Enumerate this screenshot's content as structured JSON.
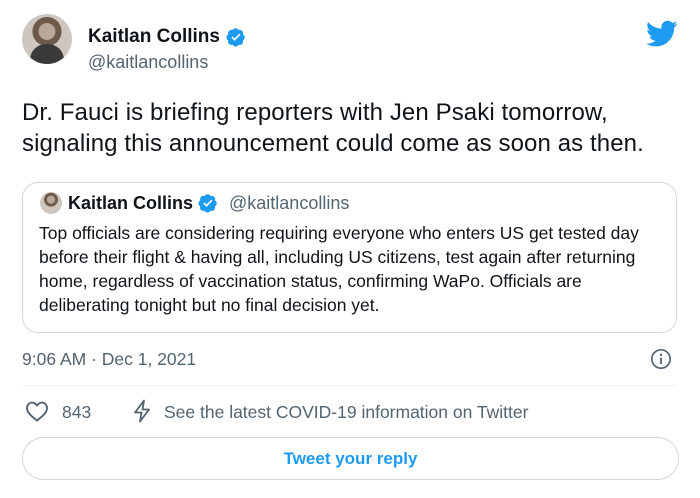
{
  "tweet": {
    "author": {
      "name": "Kaitlan Collins",
      "handle": "@kaitlancollins",
      "verified": true
    },
    "text": "Dr. Fauci is briefing reporters with Jen Psaki tomorrow, signaling this announcement could come as soon as then.",
    "quoted": {
      "author": {
        "name": "Kaitlan Collins",
        "handle": "@kaitlancollins",
        "verified": true
      },
      "text": "Top officials are considering requiring everyone who enters US get tested day before their flight & having all, including US citizens, test again after returning home, regardless of vaccination status, confirming WaPo. Officials are deliberating tonight but no final decision yet."
    },
    "timestamp": "9:06 AM · Dec 1, 2021",
    "likes": "843",
    "covid_link": "See the latest COVID-19 information on Twitter",
    "reply_button": "Tweet your reply"
  },
  "icons": {
    "brand": "twitter-bird-icon",
    "verified": "verified-badge-icon",
    "info": "info-icon",
    "like": "heart-icon",
    "covid": "lightning-bolt-icon"
  },
  "colors": {
    "accent": "#1d9bf0",
    "secondary_text": "#536471",
    "border": "#cfd9de",
    "text": "#0f1419"
  }
}
